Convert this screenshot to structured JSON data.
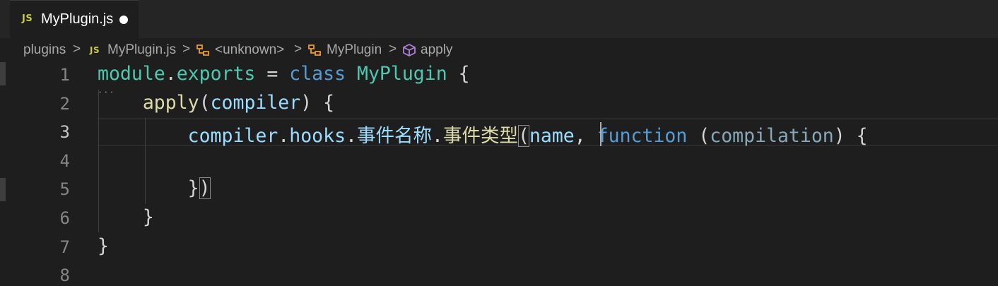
{
  "tab": {
    "badge": "JS",
    "filename": "MyPlugin.js"
  },
  "breadcrumb": {
    "folder": "plugins",
    "file_badge": "JS",
    "file": "MyPlugin.js",
    "module": "<unknown>",
    "class": "MyPlugin",
    "method": "apply",
    "separator": ">"
  },
  "colors": {
    "background": "#1e1e1e",
    "tab_bar": "#252526",
    "js_badge": "#cbcb41",
    "class_icon": "#ee9d28",
    "method_icon": "#b180d7"
  },
  "editor": {
    "line_numbers": [
      "1",
      "2",
      "3",
      "4",
      "5",
      "6",
      "7",
      "8"
    ],
    "active_line": "3",
    "lines": {
      "l1": {
        "t1": "module",
        "t2": ".",
        "t3": "exports",
        "t4": " = ",
        "t5": "class",
        "t6": " ",
        "t7": "MyPlugin",
        "t8": " {"
      },
      "l2": {
        "t1": "    ",
        "t2": "apply",
        "t3": "(",
        "t4": "compiler",
        "t5": ") {"
      },
      "l3": {
        "t1": "        ",
        "t2": "compiler",
        "t3": ".",
        "t4": "hooks",
        "t5": ".",
        "t6": "事件名称",
        "t7": ".",
        "t8": "事件类型",
        "t9": "(",
        "t10": "name",
        "t11": ", ",
        "t12": "function",
        "t13": " (",
        "t14": "compilation",
        "t15": ") {"
      },
      "l4": {
        "t1": ""
      },
      "l5": {
        "t1": "        ",
        "t2": "}",
        "t3": ")"
      },
      "l6": {
        "t1": "    ",
        "t2": "}"
      },
      "l7": {
        "t1": "}"
      },
      "l8": {
        "t1": ""
      }
    }
  }
}
